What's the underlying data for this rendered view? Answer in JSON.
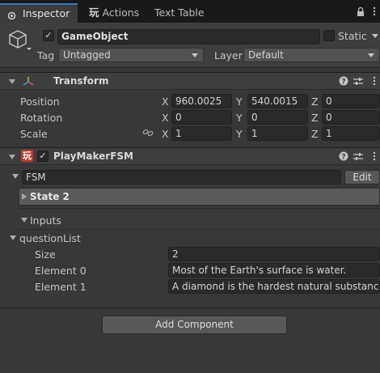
{
  "tabs": [
    {
      "label": "Inspector"
    },
    {
      "label": "Actions",
      "icon": "玩"
    },
    {
      "label": "Text Table"
    }
  ],
  "gameobject": {
    "name": "GameObject",
    "active": true,
    "static_label": "Static",
    "tag_label": "Tag",
    "tag_value": "Untagged",
    "layer_label": "Layer",
    "layer_value": "Default"
  },
  "transform": {
    "title": "Transform",
    "rows": [
      {
        "label": "Position",
        "x": "960.0025",
        "y": "540.0015",
        "z": "0"
      },
      {
        "label": "Rotation",
        "x": "0",
        "y": "0",
        "z": "0"
      },
      {
        "label": "Scale",
        "x": "1",
        "y": "1",
        "z": "1"
      }
    ],
    "axes": {
      "x": "X",
      "y": "Y",
      "z": "Z"
    }
  },
  "playmaker": {
    "title": "PlayMakerFSM",
    "icon_glyph": "玩",
    "enabled": true,
    "fsm_name": "FSM",
    "edit_label": "Edit",
    "state_label": "State 2",
    "inputs_label": "Inputs",
    "list_label": "questionList",
    "size_label": "Size",
    "size_value": "2",
    "elements": [
      {
        "label": "Element 0",
        "value": "Most of the Earth's surface is water."
      },
      {
        "label": "Element 1",
        "value": "A diamond is the hardest natural substance."
      }
    ]
  },
  "add_component_label": "Add Component",
  "colors": {
    "background": "#383838",
    "tab_bar": "#191919",
    "accent": "#3a79bb",
    "playmaker_icon": "#c0392b"
  }
}
